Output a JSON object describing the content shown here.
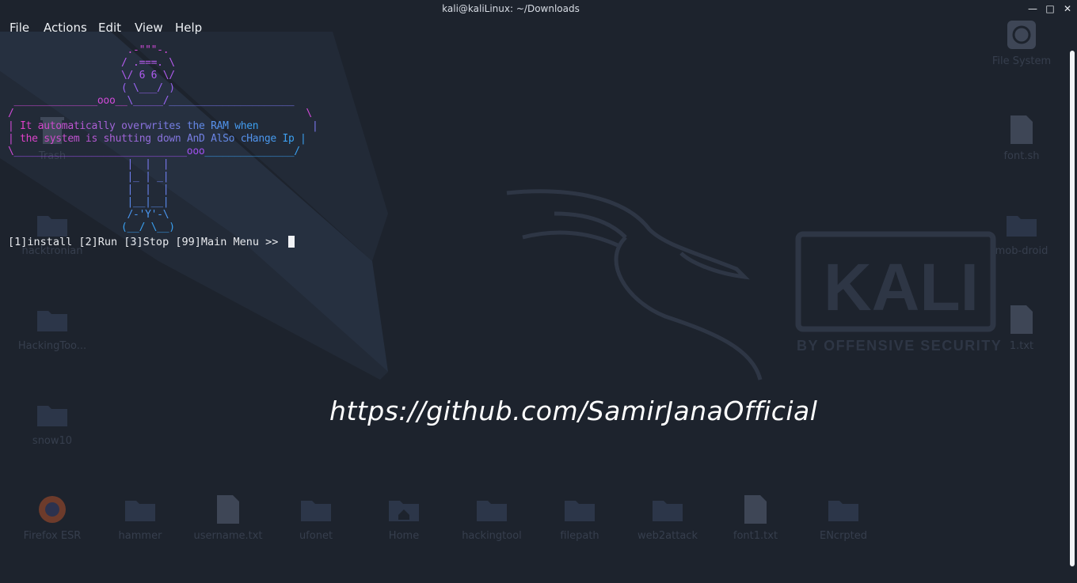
{
  "window": {
    "title": "kali@kaliLinux: ~/Downloads",
    "controls": [
      "minimize-icon",
      "maximize-icon",
      "close-icon"
    ]
  },
  "menu": [
    "File",
    "Actions",
    "Edit",
    "View",
    "Help"
  ],
  "terminal": {
    "banner_line_1": "It automatically overwrites the RAM when",
    "banner_line_2": "the system is shutting down AnD AlSo cHange Ip",
    "prompt": "[1]install [2]Run [3]Stop [99]Main Menu >> "
  },
  "overlay_url": "https://github.com/SamirJanaOfficial",
  "wallpaper": {
    "brand": "KALI",
    "tagline": "BY OFFENSIVE SECURITY"
  },
  "desktop_icons": {
    "right": [
      {
        "label": "File System",
        "icon": "drive-icon"
      },
      {
        "label": "font.sh",
        "icon": "file-icon"
      },
      {
        "label": "mob-droid",
        "icon": "folder-icon"
      },
      {
        "label": "1.txt",
        "icon": "file-icon"
      }
    ],
    "left": [
      {
        "label": "Trash",
        "icon": "trash-icon"
      },
      {
        "label": "hacktronian",
        "icon": "folder-icon"
      },
      {
        "label": "HackingToo...",
        "icon": "folder-icon"
      },
      {
        "label": "snow10",
        "icon": "folder-icon"
      }
    ],
    "bottom": [
      {
        "label": "Firefox ESR",
        "icon": "firefox-icon"
      },
      {
        "label": "hammer",
        "icon": "folder-icon"
      },
      {
        "label": "username.txt",
        "icon": "file-icon"
      },
      {
        "label": "ufonet",
        "icon": "folder-icon"
      },
      {
        "label": "Home",
        "icon": "home-folder-icon"
      },
      {
        "label": "hackingtool",
        "icon": "folder-icon"
      },
      {
        "label": "filepath",
        "icon": "folder-icon"
      },
      {
        "label": "web2attack",
        "icon": "folder-icon"
      },
      {
        "label": "font1.txt",
        "icon": "file-icon"
      },
      {
        "label": "ENcrpted",
        "icon": "folder-icon"
      }
    ]
  },
  "colors": {
    "background": "#1d232d",
    "banner_start": "#e040c8",
    "banner_mid": "#a050f0",
    "banner_end": "#3aa0f0"
  }
}
